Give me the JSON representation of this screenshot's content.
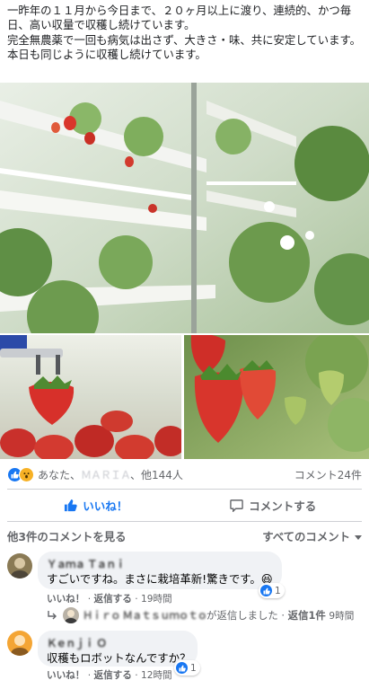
{
  "post": {
    "lines": [
      "一昨年の１１月から今日まで、２０ヶ月以上に渡り、連続的、かつ毎日、高い収量で収穫し続けています。",
      "完全無農薬で一回も病気は出さず、大きさ・味、共に安定しています。",
      "本日も同じように収穫し続けています。"
    ]
  },
  "photos": [
    {
      "subject": "vertical strawberry farm shelves"
    },
    {
      "subject": "robot arm holding strawberry"
    },
    {
      "subject": "strawberries hanging on plant"
    }
  ],
  "reactions": {
    "icons": [
      "like-icon",
      "wow-icon"
    ],
    "names_prefix": "あなた、",
    "blurred_name": "ＭＡＲＩＡ",
    "names_suffix": "、他144人",
    "comment_count": "コメント24件"
  },
  "actions": {
    "like_label": "いいね！",
    "comment_label": "コメントする"
  },
  "comments_section": {
    "view_more": "他3件のコメントを見る",
    "filter_label": "すべてのコメント"
  },
  "comments": [
    {
      "author": "Ｙａｍａ Ｔａｎｉ",
      "text": "すごいですね。まさに栽培革新!驚きです。😆",
      "like_label": "いいね！",
      "reply_label": "返信する",
      "time": "19時間",
      "reaction_count": "1",
      "reply_summary": {
        "author": "Ｈｉｒｏ Ｍａｔｓｕｍｏｔｏ",
        "action": "が返信しました",
        "count": "返信1件",
        "time": "9時間"
      }
    },
    {
      "author": "Ｋｅｎｊｉ Ｏ",
      "text": "収穫もロボットなんですか？",
      "like_label": "いいね！",
      "reply_label": "返信する",
      "time": "12時間",
      "reaction_count": "1"
    }
  ],
  "colors": {
    "facebook_blue": "#1877f2",
    "wow_yellow": "#f7b125",
    "bubble_gray": "#f0f2f5",
    "meta_gray": "#65676b"
  }
}
